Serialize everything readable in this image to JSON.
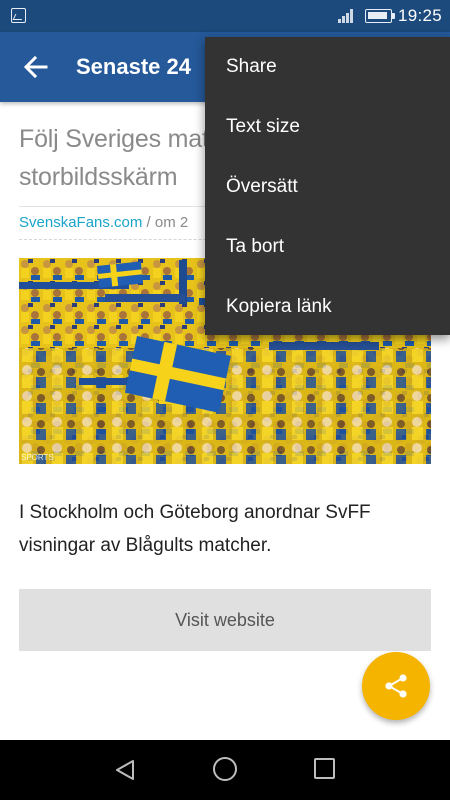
{
  "status_bar": {
    "time": "19:25",
    "icons": [
      "gallery-notification-icon",
      "signal-icon",
      "battery-icon"
    ]
  },
  "app_bar": {
    "title": "Senaste 24",
    "back_icon": "arrow-left-icon"
  },
  "article": {
    "title": "Följ Sveriges matcher på storbildsskärm",
    "source": "SvenskaFans.com",
    "separator": " / om 2",
    "image_alt": "Swedish football fans in yellow with a Swedish flag",
    "image_credit": "SPORTS",
    "body": "I Stockholm och Göteborg anordnar SvFF visningar av Blågults matcher.",
    "visit_button_label": "Visit website"
  },
  "fab": {
    "icon": "share-icon"
  },
  "overflow_menu": {
    "items": [
      {
        "label": "Share"
      },
      {
        "label": "Text size"
      },
      {
        "label": "Översätt"
      },
      {
        "label": "Ta bort"
      },
      {
        "label": "Kopiera länk"
      }
    ]
  },
  "nav_bar": {
    "icons": [
      "back-triangle-icon",
      "home-circle-icon",
      "recents-square-icon"
    ]
  },
  "colors": {
    "status_bar": "#1d4a7c",
    "app_bar": "#25599a",
    "menu_background": "#333333",
    "link": "#1ba4c9",
    "fab": "#f5b400",
    "button_background": "#e0e0e0"
  }
}
